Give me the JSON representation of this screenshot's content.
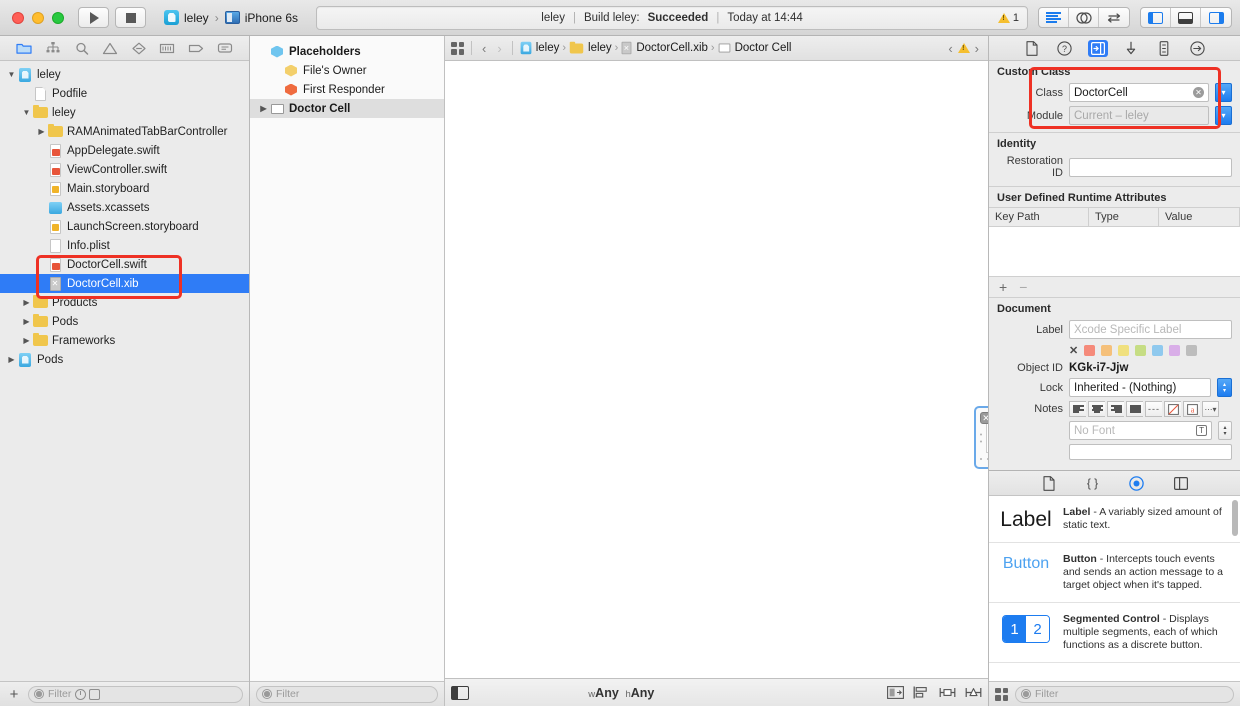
{
  "titlebar": {
    "scheme": {
      "app": "leley",
      "separator": "›",
      "device": "iPhone 6s"
    },
    "status": {
      "project": "leley",
      "sep": "|",
      "build_text": "Build leley:",
      "build_result": "Succeeded",
      "time": "Today at 14:44",
      "warning_count": "1"
    },
    "run_label": "run-button",
    "stop_label": "stop-button"
  },
  "navigator": {
    "tabs": [
      "project-navigator",
      "source-control-navigator",
      "find-navigator",
      "issue-navigator",
      "test-navigator",
      "debug-navigator",
      "breakpoint-navigator",
      "report-navigator"
    ],
    "tree": [
      {
        "label": "leley",
        "icon": "project",
        "indent": 0,
        "twirl": "open",
        "selected": false
      },
      {
        "label": "Podfile",
        "icon": "doc",
        "indent": 1,
        "twirl": "",
        "selected": false
      },
      {
        "label": "leley",
        "icon": "folder",
        "indent": 1,
        "twirl": "open",
        "selected": false
      },
      {
        "label": "RAMAnimatedTabBarController",
        "icon": "folder",
        "indent": 2,
        "twirl": "closed",
        "selected": false
      },
      {
        "label": "AppDelegate.swift",
        "icon": "swift",
        "indent": 2,
        "twirl": "",
        "selected": false
      },
      {
        "label": "ViewController.swift",
        "icon": "swift",
        "indent": 2,
        "twirl": "",
        "selected": false
      },
      {
        "label": "Main.storyboard",
        "icon": "storyboard",
        "indent": 2,
        "twirl": "",
        "selected": false
      },
      {
        "label": "Assets.xcassets",
        "icon": "xcassets",
        "indent": 2,
        "twirl": "",
        "selected": false
      },
      {
        "label": "LaunchScreen.storyboard",
        "icon": "storyboard",
        "indent": 2,
        "twirl": "",
        "selected": false
      },
      {
        "label": "Info.plist",
        "icon": "plist",
        "indent": 2,
        "twirl": "",
        "selected": false
      },
      {
        "label": "DoctorCell.swift",
        "icon": "swift",
        "indent": 2,
        "twirl": "",
        "selected": false
      },
      {
        "label": "DoctorCell.xib",
        "icon": "xib",
        "indent": 2,
        "twirl": "",
        "selected": true
      },
      {
        "label": "Products",
        "icon": "folder",
        "indent": 1,
        "twirl": "closed",
        "selected": false
      },
      {
        "label": "Pods",
        "icon": "folder",
        "indent": 1,
        "twirl": "closed",
        "selected": false
      },
      {
        "label": "Frameworks",
        "icon": "folder",
        "indent": 1,
        "twirl": "closed",
        "selected": false
      },
      {
        "label": "Pods",
        "icon": "project",
        "indent": 0,
        "twirl": "closed",
        "selected": false
      }
    ],
    "filter_placeholder": "Filter"
  },
  "outline": {
    "rows": [
      {
        "label": "Placeholders",
        "icon": "cube-blue",
        "indent": 0,
        "bold": true,
        "twirl": "",
        "selected": false
      },
      {
        "label": "File's Owner",
        "icon": "cube-yellow",
        "indent": 1,
        "bold": false,
        "twirl": "",
        "selected": false
      },
      {
        "label": "First Responder",
        "icon": "cube-orange",
        "indent": 1,
        "bold": false,
        "twirl": "",
        "selected": false
      },
      {
        "label": "Doctor Cell",
        "icon": "view",
        "indent": 0,
        "bold": true,
        "twirl": "closed",
        "selected": true
      }
    ],
    "filter_placeholder": "Filter"
  },
  "jumpbar": {
    "crumbs": [
      {
        "label": "leley",
        "icon": "project"
      },
      {
        "label": "leley",
        "icon": "folder"
      },
      {
        "label": "DoctorCell.xib",
        "icon": "xib"
      },
      {
        "label": "Doctor Cell",
        "icon": "view"
      }
    ],
    "separator": "›"
  },
  "canvas": {
    "size_class": {
      "w_prefix": "w",
      "w_value": "Any",
      "h_prefix": "h",
      "h_value": "Any"
    },
    "cell_name": "Doctor Cell",
    "autolayout_buttons": [
      "update-frames",
      "align",
      "pin",
      "resolve-auto-layout-issues"
    ]
  },
  "inspector": {
    "tabs": [
      "file-inspector",
      "quick-help-inspector",
      "identity-inspector",
      "attributes-inspector",
      "size-inspector",
      "connections-inspector"
    ],
    "active_tab": "identity-inspector",
    "custom_class": {
      "title": "Custom Class",
      "class_label": "Class",
      "class_value": "DoctorCell",
      "module_label": "Module",
      "module_placeholder": "Current – leley"
    },
    "identity": {
      "title": "Identity",
      "restoration_id_label": "Restoration ID",
      "restoration_id_value": ""
    },
    "user_defined": {
      "title": "User Defined Runtime Attributes",
      "columns": [
        "Key Path",
        "Type",
        "Value"
      ],
      "rows": [],
      "add_label": "+",
      "remove_label": "−"
    },
    "document": {
      "title": "Document",
      "label_label": "Label",
      "label_placeholder": "Xcode Specific Label",
      "swatch_clear": "✕",
      "swatches": [
        "#f58a7a",
        "#f5c07a",
        "#f0e07e",
        "#c6dd84",
        "#8fc9ee",
        "#d9aee8",
        "#bdbdbd"
      ],
      "object_id_label": "Object ID",
      "object_id_value": "KGk-i7-Jjw",
      "lock_label": "Lock",
      "lock_value": "Inherited - (Nothing)",
      "notes_label": "Notes",
      "font_placeholder": "No Font"
    }
  },
  "library": {
    "tabs": [
      "file-template-library",
      "code-snippet-library",
      "object-library",
      "media-library"
    ],
    "active_tab": "object-library",
    "items": [
      {
        "preview": "Label",
        "name": "Label",
        "dash": "-",
        "description": "A variably sized amount of static text."
      },
      {
        "preview": "Button",
        "name": "Button",
        "dash": "-",
        "description": "Intercepts touch events and sends an action message to a target object when it's tapped."
      },
      {
        "preview": "1 2",
        "name": "Segmented Control",
        "dash": "-",
        "description": "Displays multiple segments, each of which functions as a discrete button."
      }
    ],
    "filter_placeholder": "Filter"
  }
}
